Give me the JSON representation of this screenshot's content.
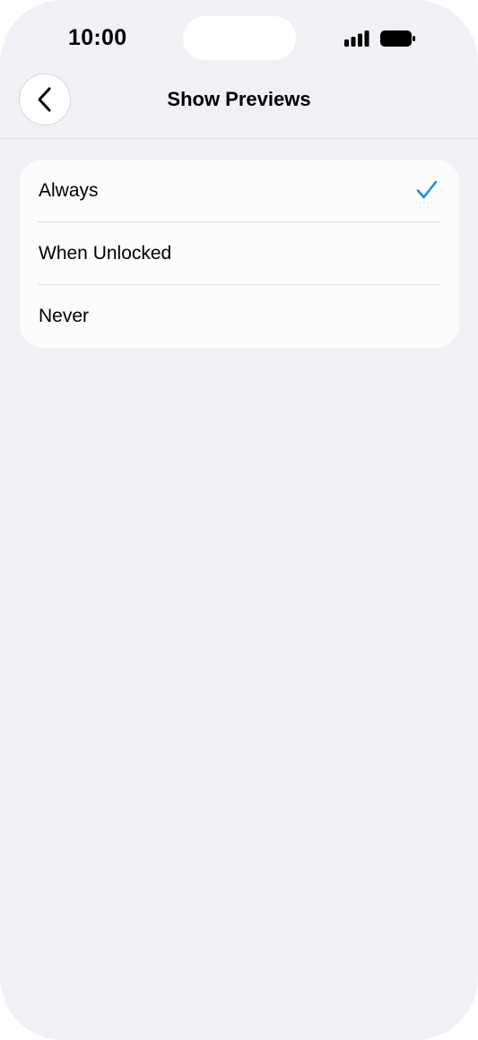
{
  "status_bar": {
    "time": "10:00",
    "icons": [
      "signal-icon",
      "battery-icon"
    ]
  },
  "nav": {
    "back_icon": "chevron-left-icon",
    "title": "Show Previews"
  },
  "options": {
    "items": [
      {
        "label": "Always",
        "selected": true
      },
      {
        "label": "When Unlocked",
        "selected": false
      },
      {
        "label": "Never",
        "selected": false
      }
    ],
    "selected_icon": "checkmark-icon"
  },
  "colors": {
    "background": "#f1f0f5",
    "card": "#fcfcfc",
    "accent": "#1a8cf0",
    "text": "#000000"
  }
}
